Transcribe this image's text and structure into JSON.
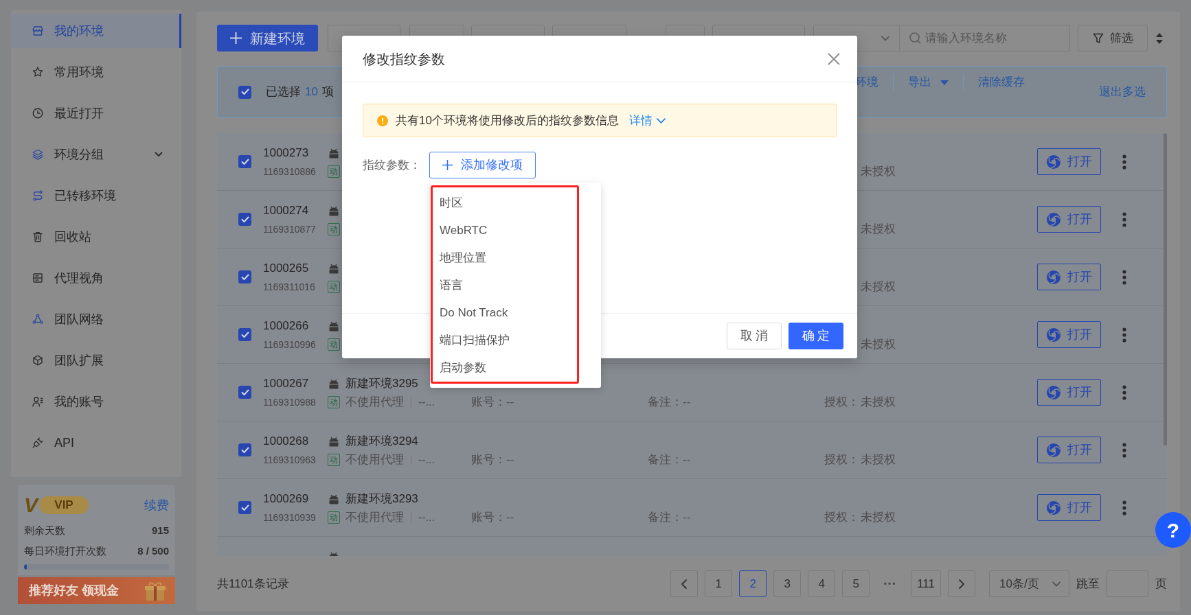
{
  "sidebar": {
    "items": [
      {
        "label": "我的环境",
        "selected": true,
        "kind": "link"
      },
      {
        "label": "常用环境",
        "selected": false,
        "kind": "link"
      },
      {
        "label": "最近打开",
        "selected": false,
        "kind": "link"
      },
      {
        "label": "环境分组",
        "selected": false,
        "kind": "group"
      },
      {
        "label": "已转移环境",
        "selected": false,
        "kind": "link"
      },
      {
        "label": "回收站",
        "selected": false,
        "kind": "link"
      },
      {
        "label": "代理视角",
        "selected": false,
        "kind": "link"
      },
      {
        "label": "团队网络",
        "selected": false,
        "kind": "link"
      },
      {
        "label": "团队扩展",
        "selected": false,
        "kind": "link"
      },
      {
        "label": "我的账号",
        "selected": false,
        "kind": "link"
      },
      {
        "label": "API",
        "selected": false,
        "kind": "link"
      }
    ],
    "vip": {
      "mark": "V",
      "badge": "VIP",
      "renew": "续费",
      "stats": [
        {
          "label": "剩余天数",
          "value": "915"
        },
        {
          "label": "每日环境打开次数",
          "value": "8 / 500"
        }
      ],
      "usage": {
        "level": 0.016
      }
    },
    "banner": {
      "text": "推荐好友 领现金"
    }
  },
  "toolbar": {
    "new_button": "新建环境",
    "buttons_under_dialog": [
      {
        "kind": "button"
      },
      {
        "kind": "button"
      },
      {
        "kind": "button"
      },
      {
        "kind": "button"
      },
      {
        "kind": "button"
      },
      {
        "kind": "button"
      },
      {
        "kind": "select"
      }
    ],
    "search": {
      "placeholder": "请输入环境名称"
    },
    "filter_button": "筛选"
  },
  "selection_bar": {
    "checked": true,
    "prefix": "已选择",
    "count": "10",
    "suffix": "项",
    "actions": [
      {
        "label": "环境",
        "kind": "link"
      },
      {
        "label": "导出",
        "kind": "dropdown"
      },
      {
        "label": "清除缓存",
        "kind": "link"
      }
    ],
    "exit": "退出多选"
  },
  "table": {
    "rows": [
      {
        "id": "1000273",
        "serial": "1169310886",
        "tag": "动",
        "auth": "未授权",
        "checked": true,
        "open_label": "打开"
      },
      {
        "id": "1000274",
        "serial": "1169310877",
        "tag": "动",
        "auth": "未授权",
        "checked": true,
        "open_label": "打开"
      },
      {
        "id": "1000265",
        "serial": "1169311016",
        "tag": "动",
        "auth": "未授权",
        "checked": true,
        "open_label": "打开"
      },
      {
        "id": "1000266",
        "serial": "1169310996",
        "tag": "动",
        "auth": "未授权",
        "checked": true,
        "open_label": "打开"
      },
      {
        "id": "1000267",
        "serial": "1169310988",
        "tag": "动",
        "name": "新建环境3295",
        "proxy": "不使用代理",
        "proxy_detail": "--...",
        "account": "账号：--",
        "note": "备注：--",
        "auth_label": "授权：",
        "auth": "未授权",
        "checked": true,
        "open_label": "打开"
      },
      {
        "id": "1000268",
        "serial": "1169310963",
        "tag": "动",
        "name": "新建环境3294",
        "proxy": "不使用代理",
        "proxy_detail": "--...",
        "account": "账号：--",
        "note": "备注：--",
        "auth_label": "授权：",
        "auth": "未授权",
        "checked": true,
        "open_label": "打开"
      },
      {
        "id": "1000269",
        "serial": "1169310939",
        "tag": "动",
        "name": "新建环境3293",
        "proxy": "不使用代理",
        "proxy_detail": "--...",
        "account": "账号：--",
        "note": "备注：--",
        "auth_label": "授权：",
        "auth": "未授权",
        "checked": true,
        "open_label": "打开"
      }
    ],
    "partial_row_below": true
  },
  "pagination": {
    "total": "共1101条记录",
    "pages": [
      {
        "label": "1",
        "kind": "page",
        "selected": false
      },
      {
        "label": "2",
        "kind": "page",
        "selected": true
      },
      {
        "label": "3",
        "kind": "page",
        "selected": false
      },
      {
        "label": "4",
        "kind": "page",
        "selected": false
      },
      {
        "label": "5",
        "kind": "page",
        "selected": false
      },
      {
        "label": "•••",
        "kind": "ellipsis",
        "selected": false
      },
      {
        "label": "111",
        "kind": "page",
        "selected": false
      }
    ],
    "page_size": "10条/页",
    "jump_label": "跳至",
    "jump_suffix": "页"
  },
  "dialog": {
    "title": "修改指纹参数",
    "notice": {
      "text": "共有10个环境将使用修改后的指纹参数信息",
      "link": "详情"
    },
    "field_label": "指纹参数：",
    "add_button": "添加修改项",
    "menu": {
      "highlighted": true,
      "items": [
        "时区",
        "WebRTC",
        "地理位置",
        "语言",
        "Do Not Track",
        "端口扫描保护",
        "启动参数"
      ]
    },
    "buttons": [
      {
        "label": "取消",
        "kind": "secondary"
      },
      {
        "label": "确定",
        "kind": "primary"
      }
    ]
  },
  "help_button": "?"
}
